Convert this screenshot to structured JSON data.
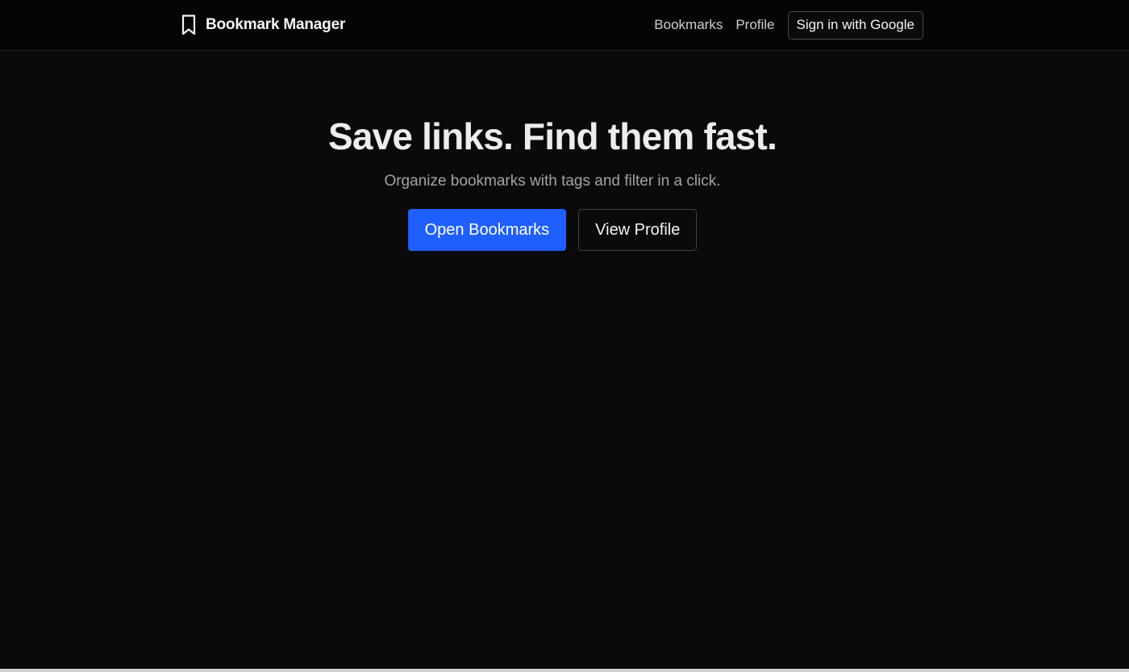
{
  "header": {
    "brand_name": "Bookmark Manager",
    "brand_icon": "bookmark-icon",
    "nav": [
      {
        "label": "Bookmarks"
      },
      {
        "label": "Profile"
      }
    ],
    "signin_label": "Sign in with Google"
  },
  "hero": {
    "title": "Save links. Find them fast.",
    "subtitle": "Organize bookmarks with tags and filter in a click.",
    "primary_button": "Open Bookmarks",
    "secondary_button": "View Profile"
  },
  "colors": {
    "background": "#0a0a0a",
    "header_background": "#050505",
    "accent": "#1f5fff",
    "text_primary": "#ededed",
    "text_muted": "#a3a3a3"
  }
}
